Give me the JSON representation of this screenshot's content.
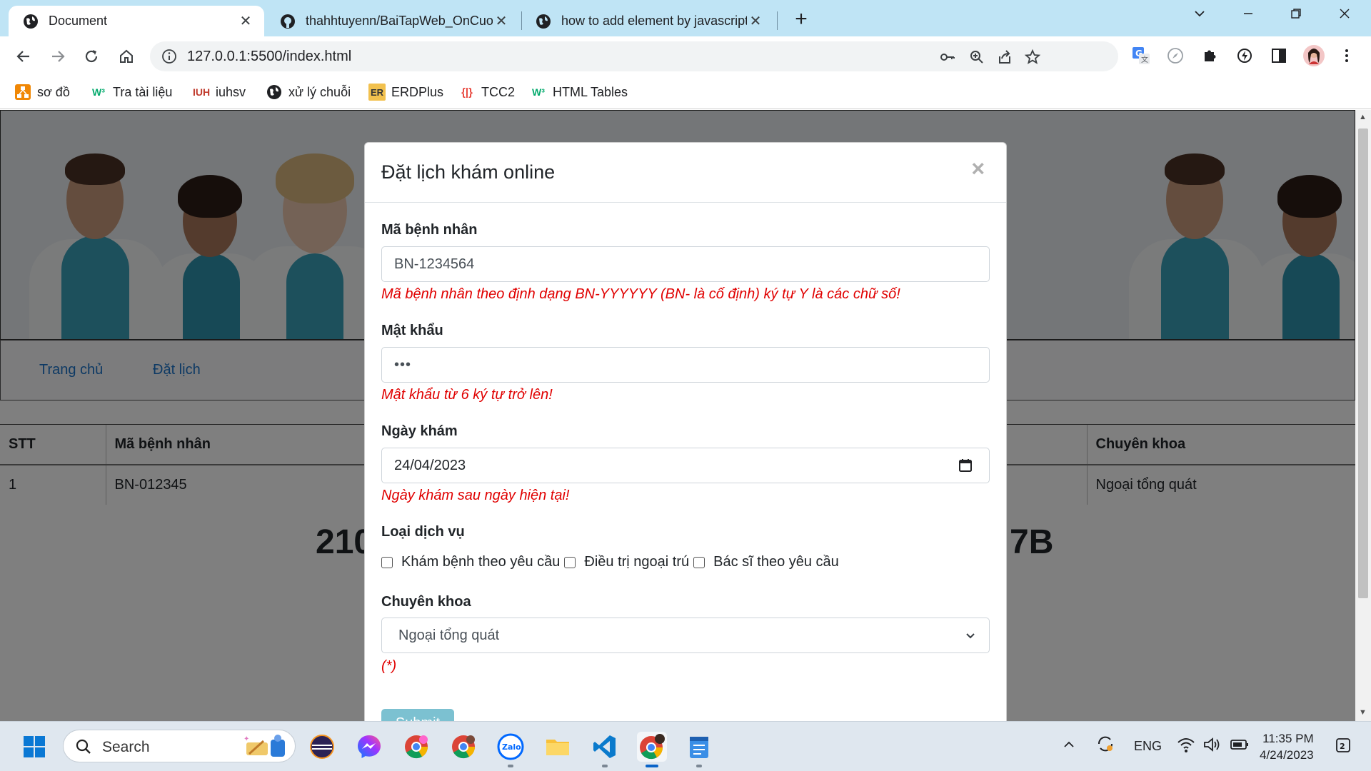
{
  "browser": {
    "tabs": [
      {
        "title": "Document",
        "active": true,
        "icon": "globe-icon"
      },
      {
        "title": "thahhtuyenn/BaiTapWeb_OnCuoi",
        "active": false,
        "icon": "github-icon"
      },
      {
        "title": "how to add element by javascript",
        "active": false,
        "icon": "globe-icon"
      }
    ],
    "url": "127.0.0.1:5500/index.html",
    "bookmarks": [
      {
        "label": "sơ đồ",
        "icon": "drawio-icon"
      },
      {
        "label": "Tra tài liệu",
        "icon": "w3schools-icon"
      },
      {
        "label": "iuhsv",
        "icon": "iuh-icon"
      },
      {
        "label": "xử lý chuỗi",
        "icon": "globe-icon"
      },
      {
        "label": "ERDPlus",
        "icon": "erdplus-icon"
      },
      {
        "label": "TCC2",
        "icon": "tcc-icon"
      },
      {
        "label": "HTML Tables",
        "icon": "w3schools-icon"
      }
    ],
    "erdplus_badge": "ER"
  },
  "page": {
    "nav": {
      "home": "Trang chủ",
      "booking": "Đặt lịch"
    },
    "table": {
      "headers": [
        "STT",
        "Mã bệnh nhân",
        "Chuyên khoa"
      ],
      "rows": [
        {
          "stt": "1",
          "patient_id": "BN-012345",
          "specialty": "Ngoại tổng quát"
        }
      ]
    },
    "big_text_left": "210",
    "big_text_right": "7B"
  },
  "modal": {
    "title": "Đặt lịch khám online",
    "close_glyph": "×",
    "patient_id": {
      "label": "Mã bệnh nhân",
      "value": "BN-1234564",
      "error": "Mã bệnh nhân theo định dạng BN-YYYYYY (BN- là cố định) ký tự Y là các chữ số!"
    },
    "password": {
      "label": "Mật khẩu",
      "value": "•••",
      "error": "Mật khẩu từ 6 ký tự trở lên!"
    },
    "date": {
      "label": "Ngày khám",
      "value": "24/04/2023",
      "error": "Ngày khám sau ngày hiện tại!"
    },
    "services": {
      "label": "Loại dịch vụ",
      "options": [
        "Khám bệnh theo yêu cầu",
        "Điều trị ngoại trú",
        "Bác sĩ theo yêu cầu"
      ]
    },
    "specialty": {
      "label": "Chuyên khoa",
      "value": "Ngoại tổng quát",
      "error": "(*)"
    },
    "submit": "Submit"
  },
  "taskbar": {
    "search_placeholder": "Search",
    "language": "ENG",
    "time": "11:35 PM",
    "date": "4/24/2023"
  },
  "colors": {
    "tabbar_bg": "#bfe4f5",
    "error_red": "#e00000",
    "link_blue": "#1a73c8",
    "submit_bg": "#7cc1d1"
  }
}
